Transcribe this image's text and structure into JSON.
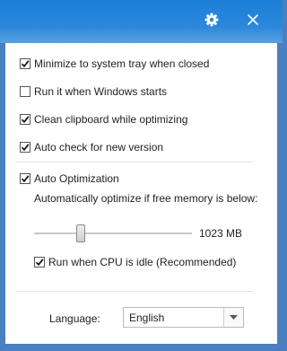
{
  "header": {
    "settings_icon": "gear-icon",
    "close_icon": "close-icon"
  },
  "options": [
    {
      "label": "Minimize to system tray when closed",
      "checked": true
    },
    {
      "label": "Run it when Windows starts",
      "checked": false
    },
    {
      "label": "Clean clipboard while optimizing",
      "checked": true
    },
    {
      "label": "Auto check for new version",
      "checked": true
    }
  ],
  "auto_optimization": {
    "label": "Auto Optimization",
    "checked": true,
    "description": "Automatically optimize if free memory is below:",
    "slider_value": "1023 MB",
    "cpu_idle_label": "Run when CPU is idle (Recommended)",
    "cpu_idle_checked": true
  },
  "language": {
    "label": "Language:",
    "selected": "English"
  }
}
